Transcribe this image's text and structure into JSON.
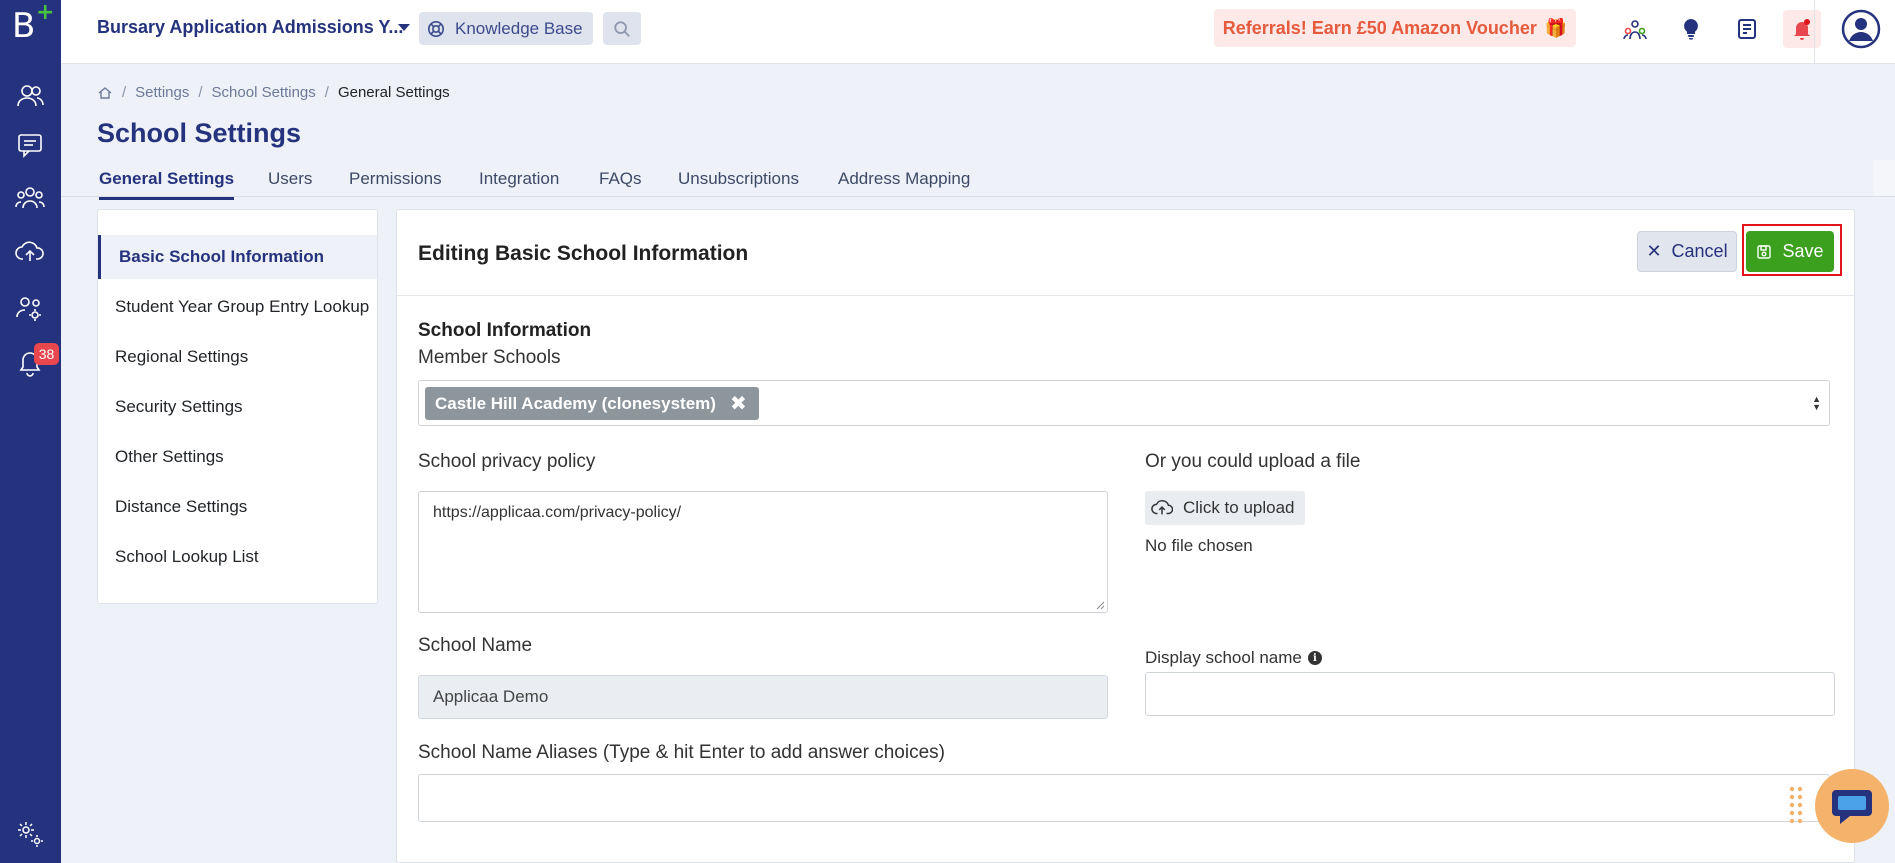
{
  "rail": {
    "logo": "B",
    "notification_count": "38"
  },
  "topbar": {
    "app_title": "Bursary Application Admissions Y...",
    "knowledge_base": "Knowledge Base",
    "referral": "Referrals! Earn £50 Amazon Voucher",
    "referral_icon": "gift-icon"
  },
  "breadcrumb": {
    "items": [
      "Settings",
      "School Settings"
    ],
    "current": "General Settings"
  },
  "page_title": "School Settings",
  "tabs": [
    "General Settings",
    "Users",
    "Permissions",
    "Integration",
    "FAQs",
    "Unsubscriptions",
    "Address Mapping"
  ],
  "sidebar": {
    "items": [
      "Basic School Information",
      "Student Year Group Entry Lookup",
      "Regional Settings",
      "Security Settings",
      "Other Settings",
      "Distance Settings",
      "School Lookup List"
    ]
  },
  "editor": {
    "title": "Editing Basic School Information",
    "cancel_label": "Cancel",
    "save_label": "Save",
    "section_title": "School Information",
    "member_schools_label": "Member Schools",
    "member_school_chip": "Castle Hill Academy (clonesystem)",
    "privacy_label": "School privacy policy",
    "privacy_value": "https://applicaa.com/privacy-policy/",
    "upload_label": "Or you could upload a file",
    "upload_button": "Click to upload",
    "upload_status": "No file chosen",
    "school_name_label": "School Name",
    "school_name_value": "Applicaa Demo",
    "display_name_label": "Display school name",
    "display_name_value": "",
    "aliases_label": "School Name Aliases (Type & hit Enter to add answer choices)",
    "aliases_value": ""
  },
  "colors": {
    "brand": "#25327d",
    "save": "#3aa01d",
    "referral_text": "#e65a3d",
    "badge": "#e8474d",
    "chat": "#f4b26a"
  }
}
